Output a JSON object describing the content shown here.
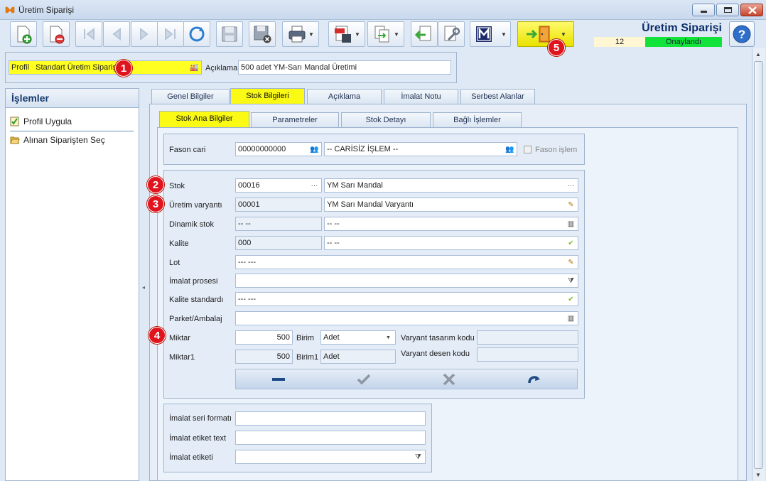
{
  "window": {
    "title": "Üretim Siparişi"
  },
  "header": {
    "title": "Üretim Siparişi",
    "record_number": "12",
    "status": "Onaylandı",
    "status_color": "#11e33a"
  },
  "profile": {
    "label": "Profil",
    "value": "Standart Üretim Siparişi",
    "description_label": "Açıklama",
    "description_value": "500 adet YM-Sarı Mandal Üretimi"
  },
  "sidebar": {
    "title": "İşlemler",
    "items": [
      {
        "label": "Profil Uygula",
        "icon": "checklist-icon"
      },
      {
        "label": "Alınan Siparişten Seç",
        "icon": "folder-open-icon"
      }
    ]
  },
  "tabs": [
    {
      "label": "Genel Bilgiler",
      "active": false
    },
    {
      "label": "Stok Bilgileri",
      "active": true
    },
    {
      "label": "Açıklama",
      "active": false
    },
    {
      "label": "İmalat Notu",
      "active": false
    },
    {
      "label": "Serbest Alanlar",
      "active": false
    }
  ],
  "subtabs": [
    {
      "label": "Stok Ana Bilgiler",
      "active": true
    },
    {
      "label": "Parametreler",
      "active": false
    },
    {
      "label": "Stok Detayı",
      "active": false
    },
    {
      "label": "Bağlı İşlemler",
      "active": false
    }
  ],
  "fason": {
    "label": "Fason cari",
    "code": "00000000000",
    "name": "-- CARİSİZ İŞLEM --",
    "checkbox_label": "Fason işlem"
  },
  "stock": {
    "stok_label": "Stok",
    "stok_code": "00016",
    "stok_name": "YM Sarı Mandal",
    "variant_label": "Üretim varyantı",
    "variant_code": "00001",
    "variant_name": "YM Sarı Mandal Varyantı",
    "dynamic_label": "Dinamik stok",
    "dynamic_code": "-- --",
    "dynamic_name": "-- --",
    "quality_label": "Kalite",
    "quality_code": "000",
    "quality_name": "-- --",
    "lot_label": "Lot",
    "lot_value": "--- ---",
    "process_label": "İmalat prosesi",
    "process_value": "",
    "standard_label": "Kalite standardı",
    "standard_value": "--- ---",
    "package_label": "Parket/Ambalaj",
    "package_value": "",
    "quantity_label": "Miktar",
    "quantity_value": "500",
    "unit_label": "Birim",
    "unit_value": "Adet",
    "quantity1_label": "Miktar1",
    "quantity1_value": "500",
    "unit1_label": "Birim1",
    "unit1_value": "Adet",
    "variant_design_label": "Varyant tasarım kodu",
    "variant_design_value": "",
    "variant_pattern_label": "Varyant desen kodu",
    "variant_pattern_value": ""
  },
  "production": {
    "serial_label": "İmalat seri formatı",
    "serial_value": "",
    "label_text_label": "İmalat etiket text",
    "label_text_value": "",
    "label_label": "İmalat etiketi",
    "label_value": ""
  },
  "callouts": [
    "1",
    "2",
    "3",
    "4",
    "5"
  ]
}
